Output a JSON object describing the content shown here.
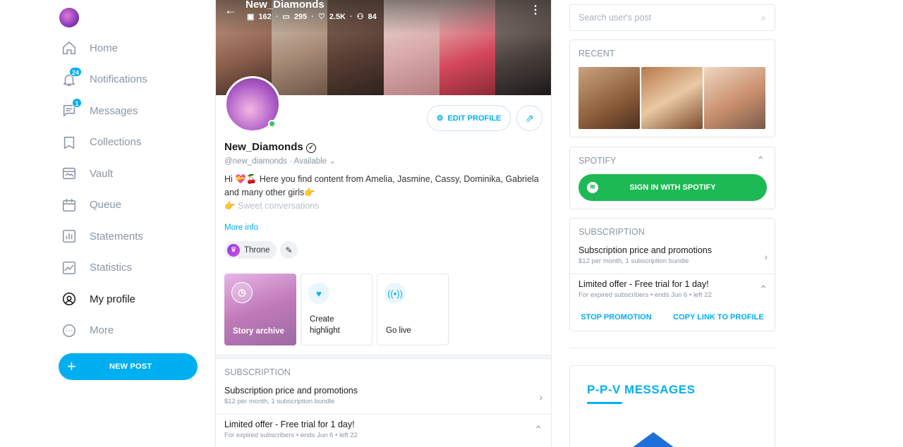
{
  "nav": {
    "items": [
      {
        "label": "Home"
      },
      {
        "label": "Notifications",
        "badge": "24"
      },
      {
        "label": "Messages",
        "badge": "1"
      },
      {
        "label": "Collections"
      },
      {
        "label": "Vault"
      },
      {
        "label": "Queue"
      },
      {
        "label": "Statements"
      },
      {
        "label": "Statistics"
      },
      {
        "label": "My profile",
        "active": true
      },
      {
        "label": "More"
      }
    ],
    "new_post": "NEW POST"
  },
  "profile": {
    "cover_name": "New_Diamonds",
    "stats": {
      "images": "162",
      "videos": "295",
      "likes": "2.5K",
      "fans": "84"
    },
    "edit_label": "EDIT PROFILE",
    "name": "New_Diamonds",
    "handle": "@new_diamonds",
    "status": "Available",
    "bio_line1": "Hi 💝🍒 Here you find content from Amelia, Jasmine, Cassy, Dominika, Gabriela",
    "bio_line2": "and many other girls👉",
    "bio_line3": "👉 Sweet conversations",
    "more_info": "More info",
    "throne": "Throne",
    "highlights": {
      "story": "Story archive",
      "create": "Create highlight",
      "live": "Go live"
    },
    "subscription": {
      "heading": "SUBSCRIPTION",
      "row1_title": "Subscription price and promotions",
      "row1_sub": "$12 per month, 1 subscription bundle",
      "row2_title": "Limited offer - Free trial for 1 day!",
      "row2_sub": "For expired subscribers • ends Jun 6 • left 22"
    }
  },
  "right": {
    "search_placeholder": "Search user's post",
    "recent_heading": "RECENT",
    "spotify_heading": "SPOTIFY",
    "spotify_button": "SIGN IN WITH SPOTIFY",
    "subscription": {
      "heading": "SUBSCRIPTION",
      "row1_title": "Subscription price and promotions",
      "row1_sub": "$12 per month, 1 subscription bundle",
      "row2_title": "Limited offer - Free trial for 1 day!",
      "row2_sub": "For expired subscribers • ends Jun 6 • left 22",
      "stop": "STOP PROMOTION",
      "copy": "COPY LINK TO PROFILE"
    },
    "ppv_title": "P-P-V  MESSAGES"
  },
  "colors": {
    "accent": "#00aff0",
    "spotify": "#1db954",
    "muted": "#8a96a3"
  }
}
